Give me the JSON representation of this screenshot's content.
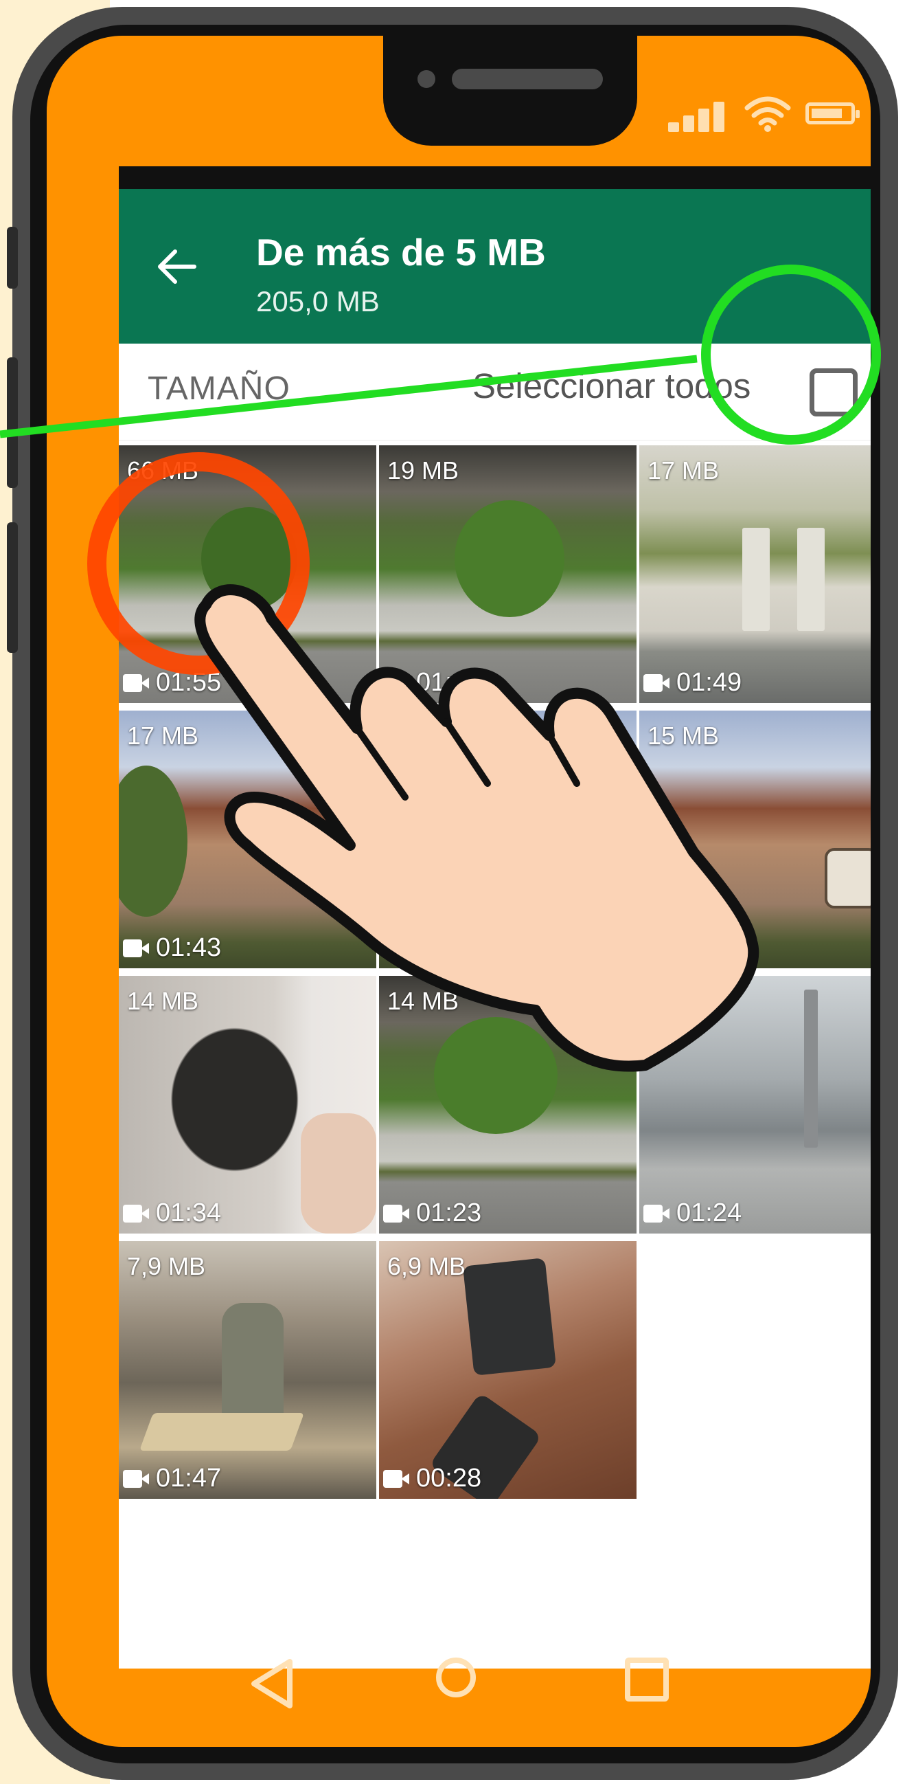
{
  "app_header": {
    "title": "De más de 5 MB",
    "subtitle": "205,0 MB"
  },
  "toolbar": {
    "sort_label": "TAMAÑO",
    "select_all_label": "Seleccionar todos",
    "select_all_checked": false
  },
  "videos": [
    {
      "size": "66 MB",
      "duration": "01:55"
    },
    {
      "size": "19 MB",
      "duration": "01:23"
    },
    {
      "size": "17 MB",
      "duration": "01:49"
    },
    {
      "size": "17 MB",
      "duration": "01:43"
    },
    {
      "size": "",
      "duration": ""
    },
    {
      "size": "15 MB",
      "duration": ""
    },
    {
      "size": "14 MB",
      "duration": "01:34"
    },
    {
      "size": "14 MB",
      "duration": "01:23"
    },
    {
      "size": "",
      "duration": "01:24"
    },
    {
      "size": "7,9 MB",
      "duration": "01:47"
    },
    {
      "size": "6,9 MB",
      "duration": "00:28"
    }
  ],
  "colors": {
    "appbar": "#0A7652",
    "phone_frame": "#FF9200",
    "highlight_tap": "#FF4500",
    "highlight_checkbox": "#22DD22",
    "background": "#FEF1D0"
  },
  "icons": [
    "back-arrow-icon",
    "signal-icon",
    "wifi-icon",
    "battery-icon",
    "video-camera-icon",
    "nav-back-icon",
    "nav-home-icon",
    "nav-recents-icon",
    "hand-pointer-icon"
  ]
}
